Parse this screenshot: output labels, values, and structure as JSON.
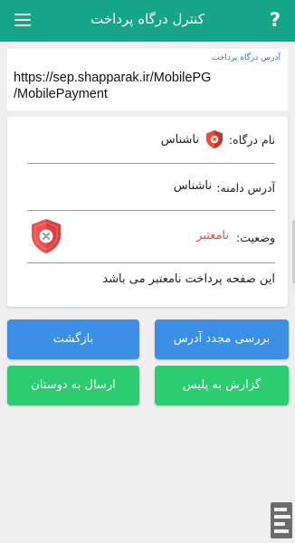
{
  "appbar": {
    "title": "کنترل درگاه پرداخت",
    "help_glyph": "?"
  },
  "url_box": {
    "label": "آدرس درگاه پرداخت",
    "url_line1": "https://sep.shapparak.ir/MobilePG",
    "url_line2": "/MobilePayment"
  },
  "info": {
    "gateway_name_label": "نام درگاه:",
    "gateway_name_value": "ناشناس",
    "domain_label": "آدرس دامنه:",
    "domain_value": "ناشناس",
    "status_label": "وضعیت:",
    "status_value": "نامعتبر",
    "status_color": "#e74c3c",
    "message": "این صفحه پرداخت نامعتبر می باشد"
  },
  "buttons": {
    "recheck": "بررسی مجدد آدرس",
    "back": "بازگشت",
    "report_police": "گزارش به پلیس",
    "send_friends": "ارسال به دوستان"
  },
  "colors": {
    "appbar": "#17a589",
    "blue_button": "#3c8fe4",
    "green_button": "#2ecc71"
  }
}
